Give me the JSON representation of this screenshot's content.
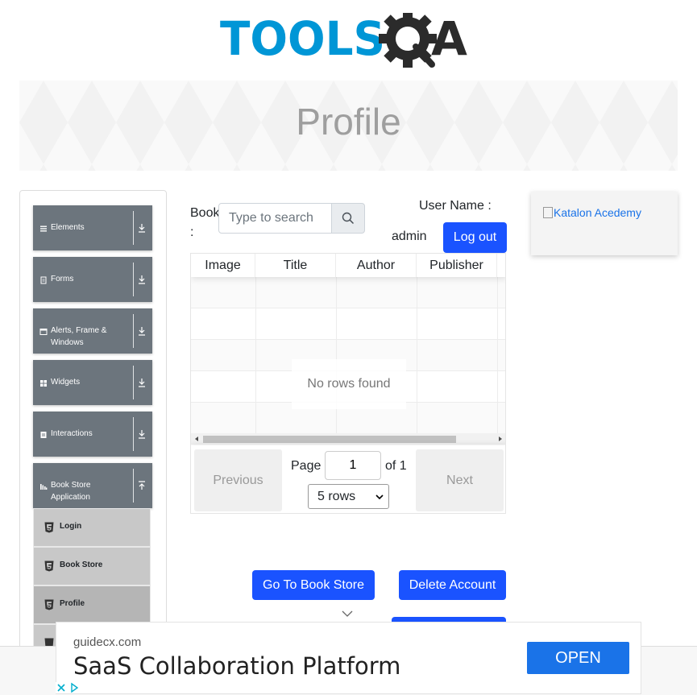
{
  "logo": {
    "text_left": "TOOLS",
    "text_right": "A"
  },
  "header": {
    "title": "Profile"
  },
  "sidebar": {
    "groups": [
      {
        "label": "Elements",
        "icon": "menu-icon"
      },
      {
        "label": "Forms",
        "icon": "form-icon"
      },
      {
        "label": "Alerts, Frame & Windows",
        "icon": "window-icon"
      },
      {
        "label": "Widgets",
        "icon": "grid-icon"
      },
      {
        "label": "Interactions",
        "icon": "interaction-icon"
      },
      {
        "label": "Book Store Application",
        "icon": "bar-chart-icon"
      }
    ],
    "book_store_items": [
      {
        "label": "Login",
        "icon": "html5-icon"
      },
      {
        "label": "Book Store",
        "icon": "html5-icon"
      },
      {
        "label": "Profile",
        "icon": "html5-icon",
        "active": true
      }
    ]
  },
  "profile": {
    "book_label": "Book :",
    "search_placeholder": "Type to search",
    "user_name_label": "User Name :",
    "user_name_value": "admin",
    "logout_label": "Log out"
  },
  "table": {
    "columns": [
      "Image",
      "Title",
      "Author",
      "Publisher"
    ],
    "empty_text": "No rows found",
    "pagination": {
      "previous": "Previous",
      "next": "Next",
      "page_label": "Page",
      "page_value": "1",
      "of_label": "of 1",
      "rows_selected": "5 rows"
    }
  },
  "actions": {
    "go_to_book_store": "Go To Book Store",
    "delete_account": "Delete Account"
  },
  "side_ad": {
    "alt_text": "Katalon Acedemy"
  },
  "bottom_ad": {
    "domain": "guidecx.com",
    "headline": "SaaS Collaboration Platform",
    "cta": "OPEN"
  },
  "colors": {
    "primary": "#1a53ff",
    "sidebar_group": "#6c757d",
    "logo_blue": "#0096d6"
  }
}
